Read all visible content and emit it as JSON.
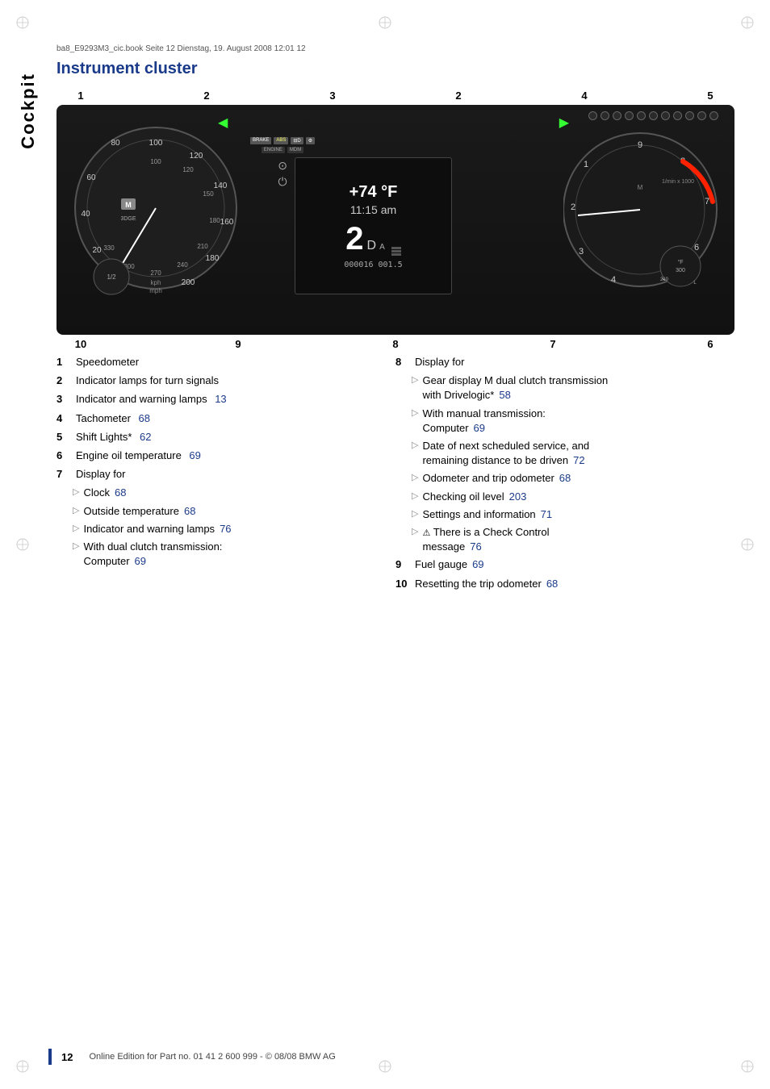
{
  "page": {
    "file_ref": "ba8_E9293M3_cic.book  Seite 12  Dienstag, 19. August 2008  12:01 12",
    "sidebar_label": "Cockpit",
    "section_title": "Instrument cluster"
  },
  "top_numbers": [
    "1",
    "2",
    "3",
    "2",
    "4",
    "5"
  ],
  "bottom_numbers": [
    "10",
    "9",
    "8",
    "7",
    "6"
  ],
  "items_left": [
    {
      "num": "1",
      "text": "Speedometer",
      "pagenum": ""
    },
    {
      "num": "2",
      "text": "Indicator lamps for turn signals",
      "pagenum": ""
    },
    {
      "num": "3",
      "text": "Indicator and warning lamps",
      "pagenum": "13"
    },
    {
      "num": "4",
      "text": "Tachometer",
      "pagenum": "68"
    },
    {
      "num": "5",
      "text": "Shift Lights*",
      "pagenum": "62"
    },
    {
      "num": "6",
      "text": "Engine oil temperature",
      "pagenum": "69"
    },
    {
      "num": "7",
      "text": "Display for",
      "pagenum": ""
    }
  ],
  "items_left_sub7": [
    {
      "text": "Clock",
      "pagenum": "68"
    },
    {
      "text": "Outside temperature",
      "pagenum": "68"
    },
    {
      "text": "Indicator and warning lamps",
      "pagenum": "76"
    },
    {
      "text": "With dual clutch transmission:\nComputer",
      "pagenum": "69"
    }
  ],
  "items_right": [
    {
      "num": "8",
      "text": "Display for",
      "pagenum": ""
    }
  ],
  "items_right_sub8": [
    {
      "text": "Gear display M dual clutch transmission\nwith Drivelogic*",
      "pagenum": "58"
    },
    {
      "text": "With manual transmission:\nComputer",
      "pagenum": "69"
    },
    {
      "text": "Date of next scheduled service, and\nremaining distance to be driven",
      "pagenum": "72"
    },
    {
      "text": "Odometer and trip odometer",
      "pagenum": "68"
    },
    {
      "text": "Checking oil level",
      "pagenum": "203"
    },
    {
      "text": "Settings and information",
      "pagenum": "71"
    },
    {
      "text": "⚠ There is a Check Control\nmessage",
      "pagenum": "76",
      "has_warn": true
    }
  ],
  "items_right_additional": [
    {
      "num": "9",
      "text": "Fuel gauge",
      "pagenum": "69"
    },
    {
      "num": "10",
      "text": "Resetting the trip odometer",
      "pagenum": "68"
    }
  ],
  "footer": {
    "page_number": "12",
    "text": "Online Edition for Part no. 01 41 2 600 999 - © 08/08 BMW AG"
  },
  "cluster": {
    "temp": "+74 °F",
    "time": "11:15 am",
    "gear": "2",
    "gear_sub": "D",
    "odo": "000016 001.5"
  }
}
